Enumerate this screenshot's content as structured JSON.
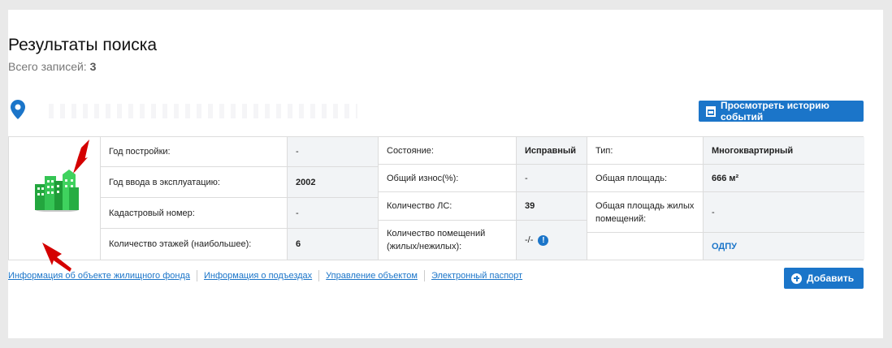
{
  "header": {
    "title": "Результаты поиска",
    "count_label": "Всего записей:",
    "count_value": "3"
  },
  "buttons": {
    "history": "Просмотреть историю событий",
    "add": "Добавить"
  },
  "card": {
    "col1": [
      {
        "label": "Год постройки:",
        "value": "-"
      },
      {
        "label": "Год ввода в эксплуатацию:",
        "value": "2002"
      },
      {
        "label": "Кадастровый номер:",
        "value": "-"
      },
      {
        "label": "Количество этажей (наибольшее):",
        "value": "6"
      }
    ],
    "col2": [
      {
        "label": "Состояние:",
        "value": "Исправный"
      },
      {
        "label": "Общий износ(%):",
        "value": "-"
      },
      {
        "label": "Количество ЛС:",
        "value": "39"
      },
      {
        "label": "Количество помещений (жилых/нежилых):",
        "value": "-/-"
      }
    ],
    "col3": [
      {
        "label": "Тип:",
        "value": "Многоквартирный"
      },
      {
        "label": "Общая площадь:",
        "value": "666 м²"
      },
      {
        "label": "Общая площадь жилых помещений:",
        "value": "-"
      },
      {
        "label": "",
        "value": "ОДПУ"
      }
    ]
  },
  "tabs": [
    "Информация об объекте жилищного фонда",
    "Информация о подъездах",
    "Управление объектом",
    "Электронный паспорт"
  ],
  "icons": {
    "location": "map-pin-icon",
    "calendar": "calendar-icon",
    "plus": "plus-circle-icon",
    "building": "building-icon",
    "info": "info-icon"
  },
  "colors": {
    "accent": "#1b75c9",
    "arrow": "#d40000",
    "building": "#2db84a"
  }
}
